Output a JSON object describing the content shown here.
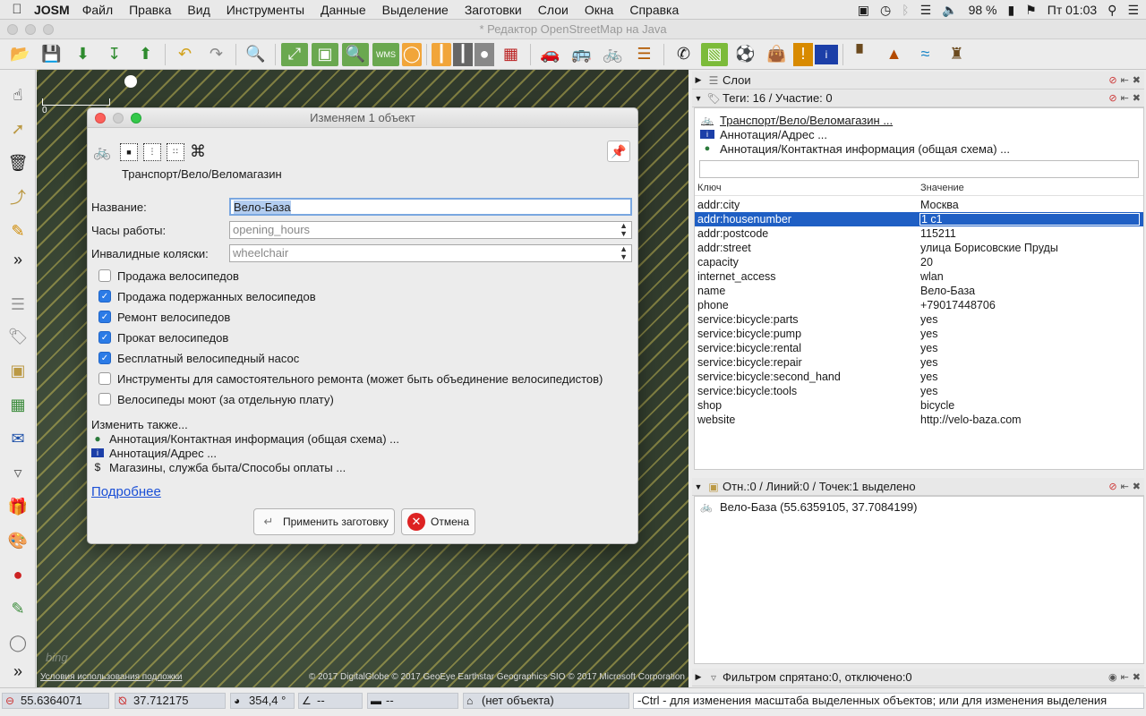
{
  "menubar": {
    "app_name": "JOSM",
    "items": [
      "Файл",
      "Правка",
      "Вид",
      "Инструменты",
      "Данные",
      "Выделение",
      "Заготовки",
      "Слои",
      "Окна",
      "Справка"
    ],
    "battery": "98 %",
    "clock": "Пт 01:03"
  },
  "window": {
    "title": "* Редактор OpenStreetMap на Java"
  },
  "map": {
    "scale_zero": "0",
    "terms": "Условия использования подложки",
    "attribution": "© 2017 DigitalGlobe © 2017 GeoEye Earthstar Geographics SIO © 2017 Microsoft Corporation",
    "watermark": "bing"
  },
  "dialog": {
    "title": "Изменяем 1 объект",
    "preset_name": "Транспорт/Вело/Веломагазин",
    "fields": {
      "name_label": "Название:",
      "name_value": "Вело-База",
      "hours_label": "Часы работы:",
      "hours_placeholder": "opening_hours",
      "wheelchair_label": "Инвалидные коляски:",
      "wheelchair_placeholder": "wheelchair"
    },
    "checkboxes": [
      {
        "label": "Продажа велосипедов",
        "checked": false
      },
      {
        "label": "Продажа подержанных велосипедов",
        "checked": true
      },
      {
        "label": "Ремонт велосипедов",
        "checked": true
      },
      {
        "label": "Прокат велосипедов",
        "checked": true
      },
      {
        "label": "Бесплатный велосипедный насос",
        "checked": true
      },
      {
        "label": "Инструменты для самостоятельного ремонта (может быть объединение велосипедистов)",
        "checked": false
      },
      {
        "label": "Велосипеды моют (за отдельную плату)",
        "checked": false
      }
    ],
    "also_title": "Изменить также...",
    "also_items": [
      {
        "icon": "globe-icon",
        "label": "Аннотация/Контактная информация (общая схема) ..."
      },
      {
        "icon": "address-card-icon",
        "label": "Аннотация/Адрес ..."
      },
      {
        "icon": "dollar-icon",
        "label": "Магазины, служба быта/Способы оплаты ..."
      }
    ],
    "more_link": "Подробнее",
    "apply_button": "Применить заготовку",
    "cancel_button": "Отмена"
  },
  "layers_panel": {
    "title": "Слои"
  },
  "tags_panel": {
    "title": "Теги: 16 / Участие: 0",
    "presets": [
      {
        "icon": "bicycle-icon",
        "label": "Транспорт/Вело/Веломагазин ..."
      },
      {
        "icon": "address-card-icon",
        "label": "Аннотация/Адрес ..."
      },
      {
        "icon": "globe-icon",
        "label": "Аннотация/Контактная информация (общая схема) ..."
      }
    ],
    "col_key": "Ключ",
    "col_value": "Значение",
    "rows": [
      {
        "key": "addr:city",
        "value": "Москва"
      },
      {
        "key": "addr:housenumber",
        "value": "1 с1"
      },
      {
        "key": "addr:postcode",
        "value": "115211"
      },
      {
        "key": "addr:street",
        "value": "улица Борисовские Пруды"
      },
      {
        "key": "capacity",
        "value": "20"
      },
      {
        "key": "internet_access",
        "value": "wlan"
      },
      {
        "key": "name",
        "value": "Вело-База"
      },
      {
        "key": "phone",
        "value": "+79017448706"
      },
      {
        "key": "service:bicycle:parts",
        "value": "yes"
      },
      {
        "key": "service:bicycle:pump",
        "value": "yes"
      },
      {
        "key": "service:bicycle:rental",
        "value": "yes"
      },
      {
        "key": "service:bicycle:repair",
        "value": "yes"
      },
      {
        "key": "service:bicycle:second_hand",
        "value": "yes"
      },
      {
        "key": "service:bicycle:tools",
        "value": "yes"
      },
      {
        "key": "shop",
        "value": "bicycle"
      },
      {
        "key": "website",
        "value": "http://velo-baza.com"
      }
    ],
    "selected_row": 1
  },
  "selection_panel": {
    "title": "Отн.:0 / Линий:0 / Точек:1 выделено",
    "item": "Вело-База (55.6359105, 37.7084199)"
  },
  "filter_panel": {
    "title": "Фильтром спрятано:0, отключено:0"
  },
  "statusbar": {
    "lat": "55.6364071",
    "lon": "37.712175",
    "heading": "354,4 °",
    "angle": "--",
    "distance": "--",
    "object": "(нет объекта)",
    "message": "-Ctrl - для изменения масштаба выделенных объектов; или для изменения выделения"
  },
  "colors": {
    "selection": "#1f5fc4",
    "checkbox_on": "#2b7be6",
    "link": "#1a4fd6"
  }
}
